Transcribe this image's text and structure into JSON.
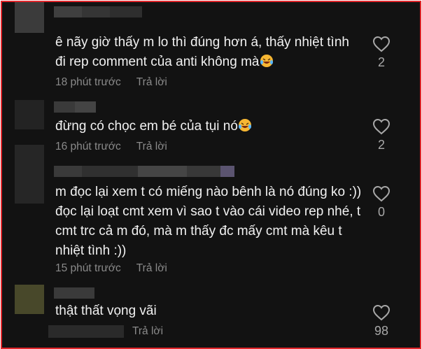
{
  "comments": [
    {
      "text": "ê nãy giờ thấy m lo thì đúng hơn á, thấy nhiệt tình đi rep comment của anti không mà",
      "emoji": "rofl-emoji",
      "time": "18 phút trước",
      "reply": "Trả lời",
      "likes": "2",
      "avatar_color": "#3a3a3a"
    },
    {
      "text": "đừng có chọc em bé của tụi nó",
      "emoji": "rofl-emoji",
      "time": "16 phút trước",
      "reply": "Trả lời",
      "likes": "2",
      "avatar_color": "#242424"
    },
    {
      "text": "m đọc lại xem t có miếng nào bênh là nó đúng ko :)) đọc lại loạt cmt xem vì sao t vào cái video rep nhé, t cmt trc cả m đó, mà m thấy đc mấy cmt mà kêu t nhiệt tình :))",
      "time": "15 phút trước",
      "reply": "Trả lời",
      "likes": "0",
      "avatar_color": "#2a2a2a"
    },
    {
      "text": "thật thất vọng vãi",
      "time": "",
      "reply": "Trả lời",
      "likes": "98",
      "avatar_color": "#4a4a2a"
    }
  ],
  "colors": {
    "border": "#e0262b",
    "background": "#121212",
    "text": "#f1f1f1",
    "muted": "#8a8a8a"
  },
  "icons": {
    "like": "heart-outline-icon"
  }
}
